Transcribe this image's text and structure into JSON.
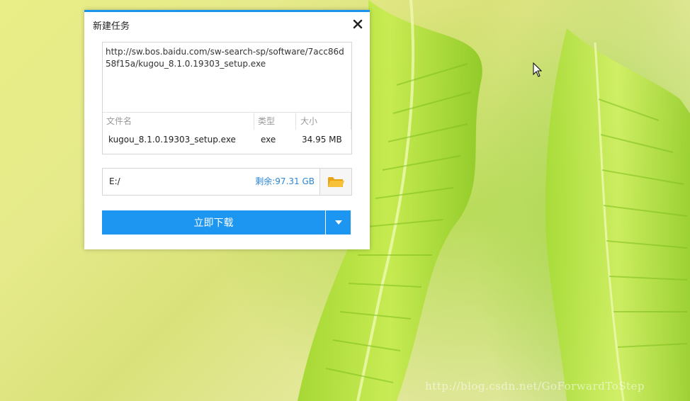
{
  "dialog": {
    "title": "新建任务",
    "url": "http://sw.bos.baidu.com/sw-search-sp/software/7acc86d58f15a/kugou_8.1.0.19303_setup.exe",
    "columns": {
      "name": "文件名",
      "type": "类型",
      "size": "大小"
    },
    "file": {
      "name": "kugou_8.1.0.19303_setup.exe",
      "type": "exe",
      "size": "34.95 MB"
    },
    "save_path": "E:/",
    "free_space": "剩余:97.31 GB",
    "download_label": "立即下载"
  },
  "watermark": "http://blog.csdn.net/GoForwardToStep",
  "colors": {
    "accent": "#1d96f2",
    "free_space_text": "#2b86d6",
    "folder_icon": "#f5b31b"
  },
  "icons": {
    "close": "close-icon",
    "folder": "folder-icon",
    "dropdown": "chevron-down-icon",
    "cursor": "mouse-cursor-icon"
  }
}
